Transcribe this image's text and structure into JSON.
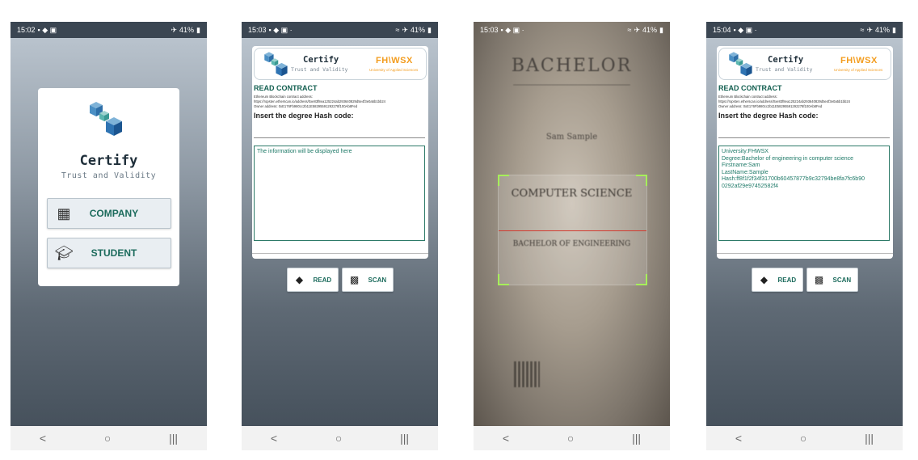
{
  "phone1": {
    "status": {
      "time": "15:02",
      "battery": "41%"
    },
    "card": {
      "title": "Certify",
      "subtitle": "Trust and Validity"
    },
    "buttons": [
      {
        "label": "COMPANY",
        "icon": "building-icon"
      },
      {
        "label": "STUDENT",
        "icon": "graduation-cap-icon"
      }
    ]
  },
  "phone2": {
    "status": {
      "time": "15:03",
      "battery": "41%"
    },
    "header": {
      "title": "Certify",
      "subtitle": "Trust and Validity",
      "partner": "FH\\WSX",
      "partner_sub": "University of Applied Sciences"
    },
    "read_contract": "READ CONTRACT",
    "contract_label": "Ethereum Blockchain contract address:",
    "contract_url": "https://ropsten.etherscan.io/address/0xe83f8ea125224ab29364082­9d5e4f3e0a5b1bb24",
    "owner": "Owner address: 0xE176Fb980cc2b11E5829559129227­8f100Ab8Fed",
    "insert_label": "Insert the degree Hash code:",
    "info_placeholder": "The information will be displayed here",
    "read_button": "READ",
    "scan_button": "SCAN"
  },
  "phone3": {
    "status": {
      "time": "15:03",
      "battery": "41%"
    },
    "texts": {
      "bachelor": "BACHELOR",
      "name": "Sam Sample",
      "cs": "COMPUTER SCIENCE",
      "degree": "BACHELOR OF ENGINEERING"
    }
  },
  "phone4": {
    "status": {
      "time": "15:04",
      "battery": "41%"
    },
    "header": {
      "title": "Certify",
      "subtitle": "Trust and Validity",
      "partner": "FH\\WSX",
      "partner_sub": "University of Applied Sciences"
    },
    "read_contract": "READ CONTRACT",
    "contract_label": "Ethereum Blockchain contract address:",
    "contract_url": "https://ropsten.etherscan.io/address/0xe83f8ea125224ab29364082­9d5e4f3e0a5b1bb24",
    "owner": "Owner address: 0xE176Fb980cc2b11E5829559129227­8f100Ab8Fed",
    "insert_label": "Insert the degree Hash code:",
    "info_lines": [
      "University:FHWSX",
      "Degree:Bachelor of engineering in computer science",
      "Firstname:Sam",
      "LastName:Sample",
      "Hash:ff8f1f2f34f31700b60457877b9c32794be8fa7fc6b90",
      "0292af29e97452582f4"
    ],
    "read_button": "READ",
    "scan_button": "SCAN"
  },
  "nav": {
    "back": "<",
    "home": "○",
    "recent": "|||"
  }
}
